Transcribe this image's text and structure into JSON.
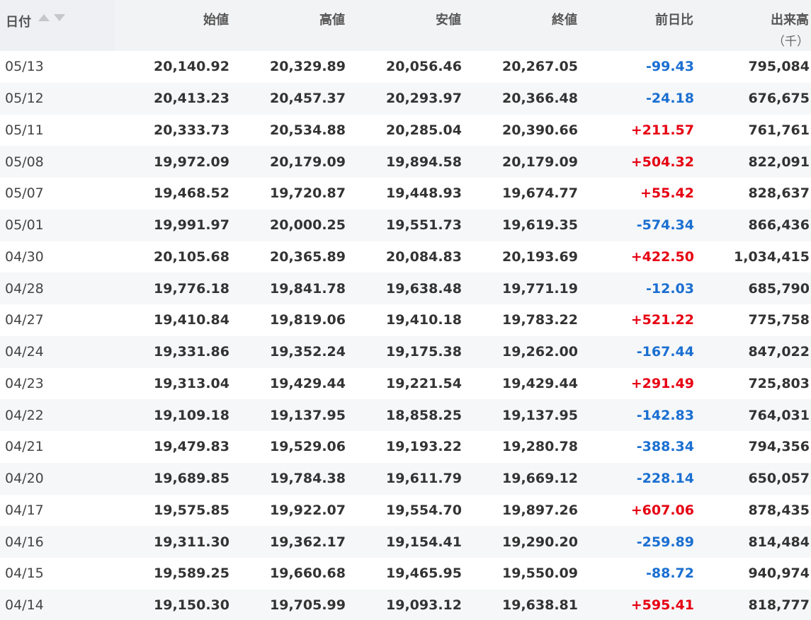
{
  "headers": {
    "date": "日付",
    "open": "始値",
    "high": "高値",
    "low": "安値",
    "close": "終値",
    "change": "前日比",
    "volume": "出来高",
    "volume_unit": "（千）"
  },
  "colors": {
    "negative": "#1a6fd1",
    "positive": "#e60012"
  },
  "rows": [
    {
      "date": "05/13",
      "open": "20,140.92",
      "high": "20,329.89",
      "low": "20,056.46",
      "close": "20,267.05",
      "change": "-99.43",
      "volume": "795,084"
    },
    {
      "date": "05/12",
      "open": "20,413.23",
      "high": "20,457.37",
      "low": "20,293.97",
      "close": "20,366.48",
      "change": "-24.18",
      "volume": "676,675"
    },
    {
      "date": "05/11",
      "open": "20,333.73",
      "high": "20,534.88",
      "low": "20,285.04",
      "close": "20,390.66",
      "change": "+211.57",
      "volume": "761,761"
    },
    {
      "date": "05/08",
      "open": "19,972.09",
      "high": "20,179.09",
      "low": "19,894.58",
      "close": "20,179.09",
      "change": "+504.32",
      "volume": "822,091"
    },
    {
      "date": "05/07",
      "open": "19,468.52",
      "high": "19,720.87",
      "low": "19,448.93",
      "close": "19,674.77",
      "change": "+55.42",
      "volume": "828,637"
    },
    {
      "date": "05/01",
      "open": "19,991.97",
      "high": "20,000.25",
      "low": "19,551.73",
      "close": "19,619.35",
      "change": "-574.34",
      "volume": "866,436"
    },
    {
      "date": "04/30",
      "open": "20,105.68",
      "high": "20,365.89",
      "low": "20,084.83",
      "close": "20,193.69",
      "change": "+422.50",
      "volume": "1,034,415"
    },
    {
      "date": "04/28",
      "open": "19,776.18",
      "high": "19,841.78",
      "low": "19,638.48",
      "close": "19,771.19",
      "change": "-12.03",
      "volume": "685,790"
    },
    {
      "date": "04/27",
      "open": "19,410.84",
      "high": "19,819.06",
      "low": "19,410.18",
      "close": "19,783.22",
      "change": "+521.22",
      "volume": "775,758"
    },
    {
      "date": "04/24",
      "open": "19,331.86",
      "high": "19,352.24",
      "low": "19,175.38",
      "close": "19,262.00",
      "change": "-167.44",
      "volume": "847,022"
    },
    {
      "date": "04/23",
      "open": "19,313.04",
      "high": "19,429.44",
      "low": "19,221.54",
      "close": "19,429.44",
      "change": "+291.49",
      "volume": "725,803"
    },
    {
      "date": "04/22",
      "open": "19,109.18",
      "high": "19,137.95",
      "low": "18,858.25",
      "close": "19,137.95",
      "change": "-142.83",
      "volume": "764,031"
    },
    {
      "date": "04/21",
      "open": "19,479.83",
      "high": "19,529.06",
      "low": "19,193.22",
      "close": "19,280.78",
      "change": "-388.34",
      "volume": "794,356"
    },
    {
      "date": "04/20",
      "open": "19,689.85",
      "high": "19,784.38",
      "low": "19,611.79",
      "close": "19,669.12",
      "change": "-228.14",
      "volume": "650,057"
    },
    {
      "date": "04/17",
      "open": "19,575.85",
      "high": "19,922.07",
      "low": "19,554.70",
      "close": "19,897.26",
      "change": "+607.06",
      "volume": "878,435"
    },
    {
      "date": "04/16",
      "open": "19,311.30",
      "high": "19,362.17",
      "low": "19,154.41",
      "close": "19,290.20",
      "change": "-259.89",
      "volume": "814,484"
    },
    {
      "date": "04/15",
      "open": "19,589.25",
      "high": "19,660.68",
      "low": "19,465.95",
      "close": "19,550.09",
      "change": "-88.72",
      "volume": "940,974"
    },
    {
      "date": "04/14",
      "open": "19,150.30",
      "high": "19,705.99",
      "low": "19,093.12",
      "close": "19,638.81",
      "change": "+595.41",
      "volume": "818,777"
    }
  ]
}
